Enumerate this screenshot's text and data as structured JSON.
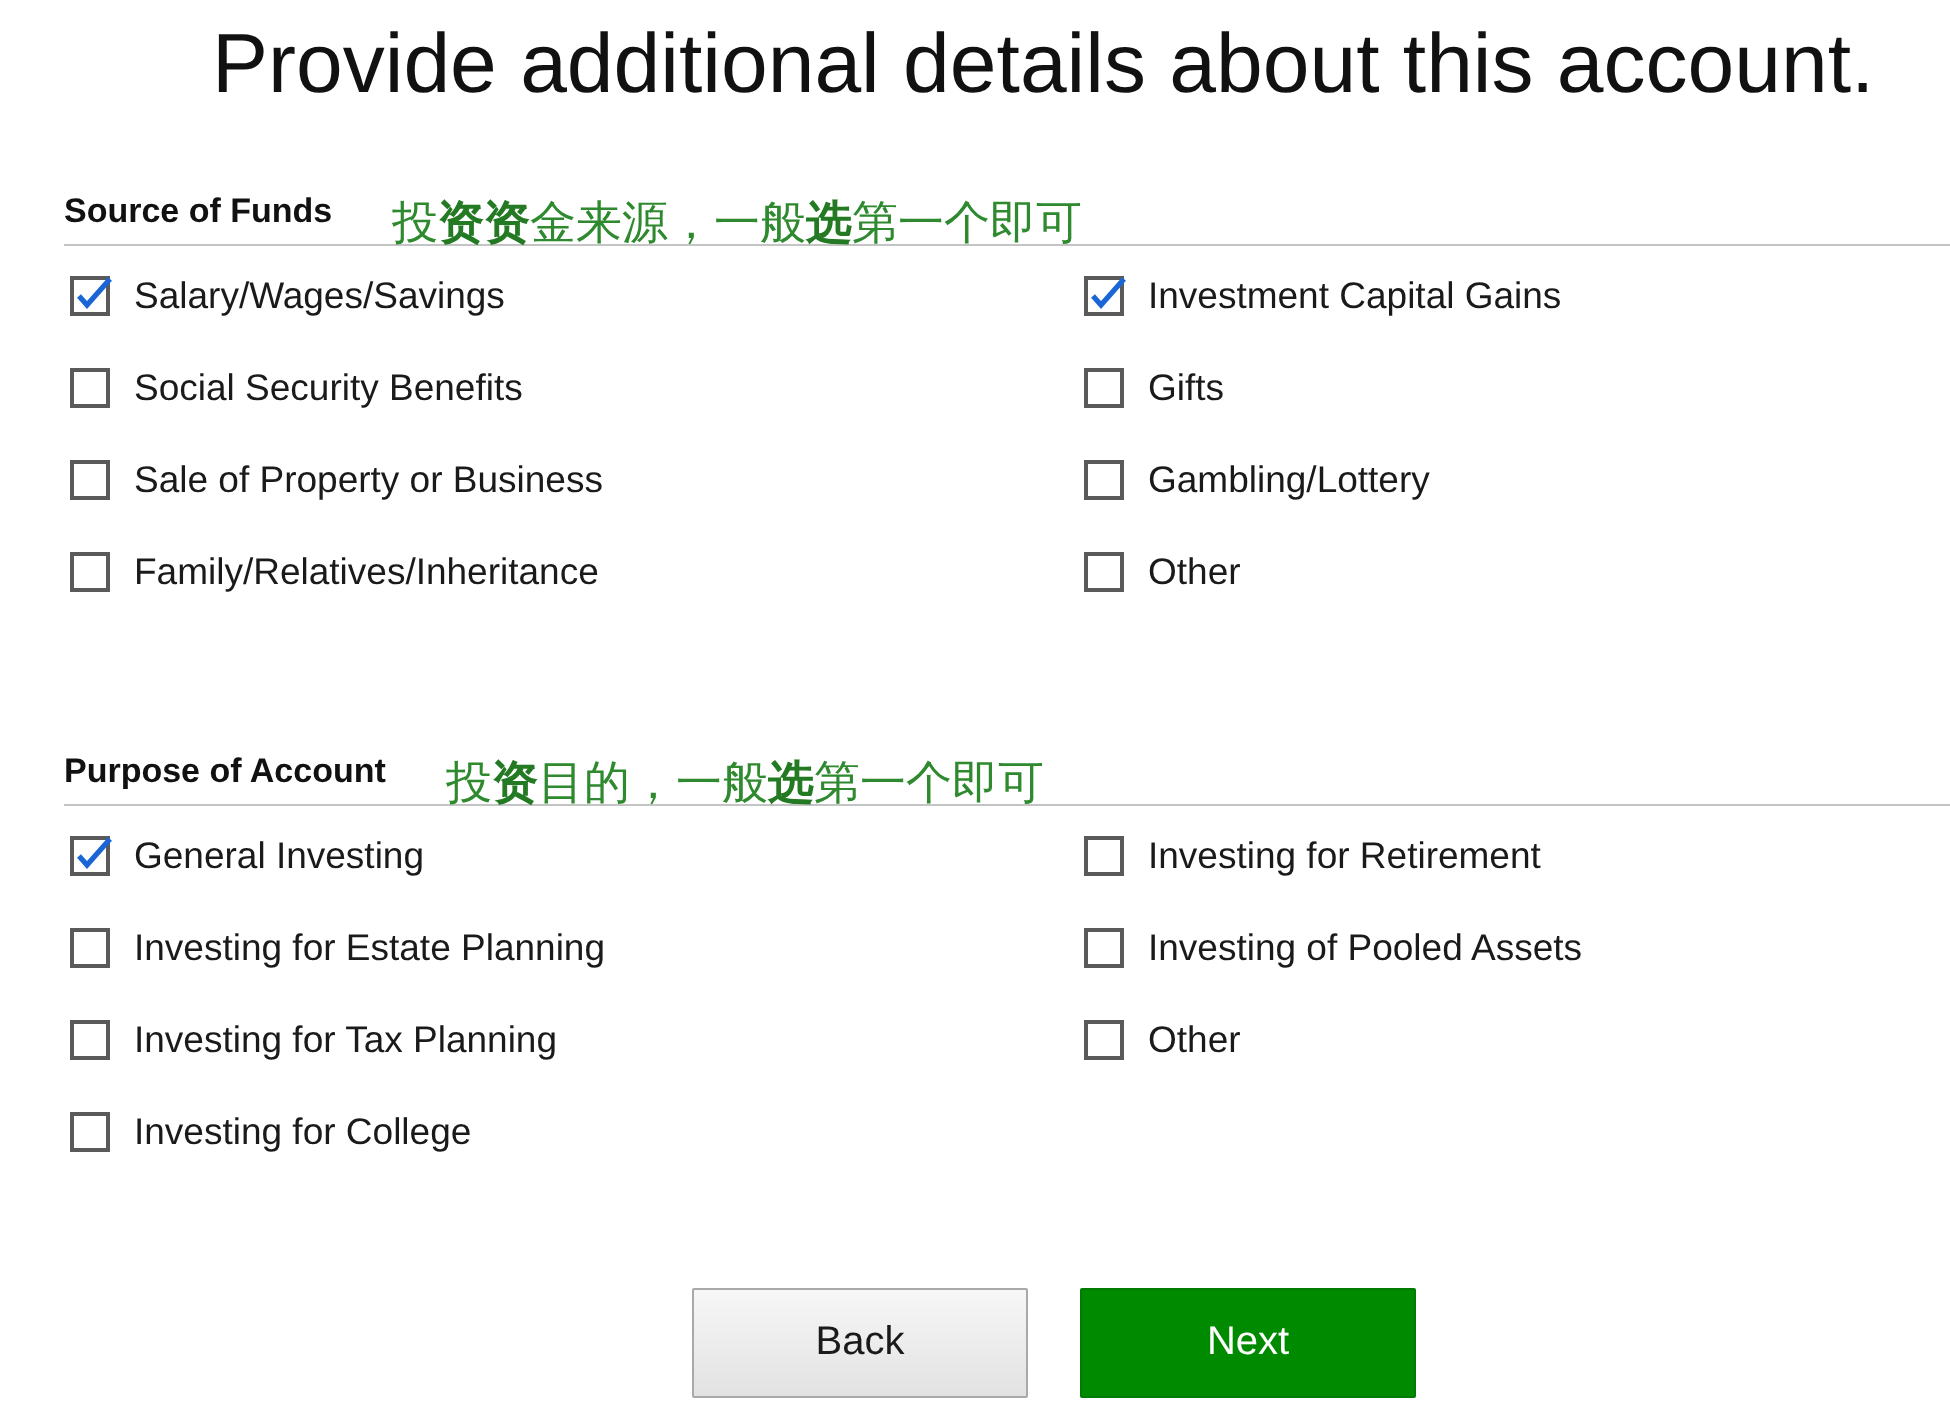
{
  "title": "Provide additional details about this account.",
  "sections": [
    {
      "heading": "Source of Funds",
      "note": "投**资资**金来源，一般**选**第一个即可",
      "columns": [
        {
          "options": [
            {
              "label": "Salary/Wages/Savings",
              "checked": true
            },
            {
              "label": "Social Security Benefits",
              "checked": false
            },
            {
              "label": "Sale of Property or Business",
              "checked": false
            },
            {
              "label": "Family/Relatives/Inheritance",
              "checked": false
            }
          ]
        },
        {
          "options": [
            {
              "label": "Investment Capital Gains",
              "checked": true
            },
            {
              "label": "Gifts",
              "checked": false
            },
            {
              "label": "Gambling/Lottery",
              "checked": false
            },
            {
              "label": "Other",
              "checked": false
            }
          ]
        }
      ]
    },
    {
      "heading": "Purpose of Account",
      "note": "投**资**目的，一般**选**第一个即可",
      "columns": [
        {
          "options": [
            {
              "label": "General Investing",
              "checked": true
            },
            {
              "label": "Investing for Estate Planning",
              "checked": false
            },
            {
              "label": "Investing for Tax Planning",
              "checked": false
            },
            {
              "label": "Investing for College",
              "checked": false
            }
          ]
        },
        {
          "options": [
            {
              "label": "Investing for Retirement",
              "checked": false
            },
            {
              "label": "Investing of Pooled Assets",
              "checked": false
            },
            {
              "label": "Other",
              "checked": false
            }
          ]
        }
      ]
    }
  ],
  "buttons": [
    {
      "label": "Back",
      "kind": "secondary"
    },
    {
      "label": "Next",
      "kind": "primary"
    }
  ]
}
